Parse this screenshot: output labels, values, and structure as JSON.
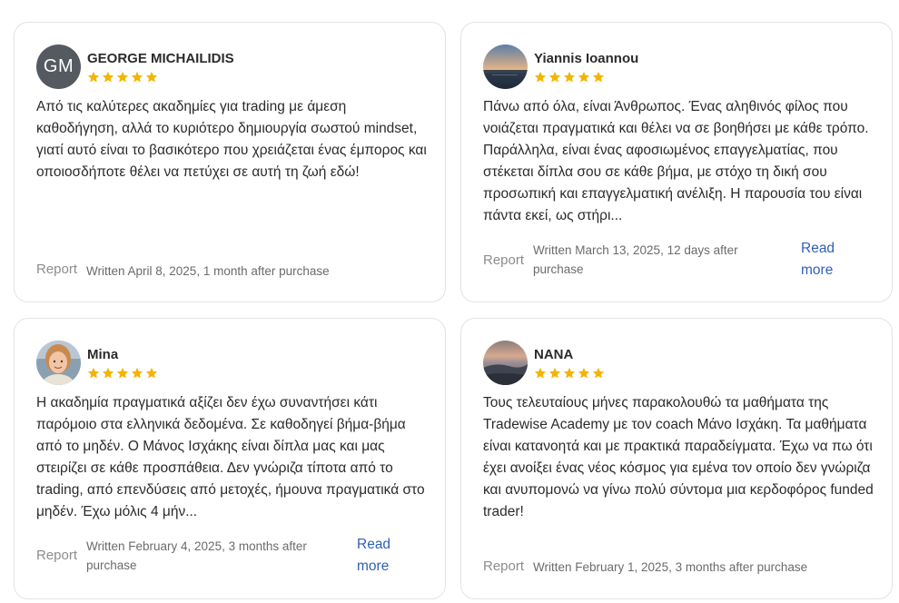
{
  "review_card_label": "Report",
  "colors": {
    "star": "#f4b400",
    "link": "#2f5fb8",
    "avatar_bg": "#555a60"
  },
  "reviews": [
    {
      "avatar_initials": "GM",
      "name": "GEORGE MICHAILIDIS",
      "rating": 5,
      "body": "Από τις καλύτερες ακαδημίες για trading με άμεση καθοδήγηση, αλλά το κυριότερο δημιουργία σωστού mindset, γιατί αυτό είναι το βασικότερο που χρειάζεται ένας έμπορος και οποιοσδήποτε θέλει να πετύχει σε αυτή τη ζωή εδώ!",
      "report": "Report",
      "written": "Written April 8, 2025, 1 month after purchase"
    },
    {
      "avatar_icon": "sunset-photo-avatar",
      "name": "Yiannis Ioannou",
      "rating": 5,
      "body": "Πάνω από όλα, είναι Άνθρωπος. Ένας αληθινός φίλος που νοιάζεται πραγματικά και θέλει να σε βοηθήσει με κάθε τρόπο. Παράλληλα, είναι ένας αφοσιωμένος επαγγελματίας, που στέκεται δίπλα σου σε κάθε βήμα, με στόχο τη δική σου προσωπική και επαγγελματική ανέλιξη. Η παρουσία του είναι πάντα εκεί, ως στήρι...",
      "report": "Report",
      "written": "Written March 13, 2025, 12 days after purchase",
      "read_more": [
        "Read",
        "more"
      ]
    },
    {
      "avatar_icon": "person-photo-avatar",
      "name": "Mina",
      "rating": 5,
      "body": "Η ακαδημία πραγματικά αξίζει δεν έχω συναντήσει κάτι παρόμοιο στα ελληνικά δεδομένα. Σε καθοδηγεί βήμα-βήμα από το μηδέν. Ο Μάνος Ισχάκης είναι δίπλα μας και μας στειρίζει σε κάθε προσπάθεια. Δεν γνώριζα τίποτα από το trading, από επενδύσεις από μετοχές, ήμουνα πραγματικά στο μηδέν. Έχω μόλις 4 μήν...",
      "report": "Report",
      "written": "Written February 4, 2025, 3 months after purchase",
      "read_more": [
        "Read",
        "more"
      ]
    },
    {
      "avatar_icon": "landscape-photo-avatar",
      "name": "NANA",
      "rating": 5,
      "body": "Τους τελευταίους μήνες παρακολουθώ τα μαθήματα της Tradewise Academy με τον coach Μάνο Ισχάκη. Τα μαθήματα είναι κατανοητά και με πρακτικά παραδείγματα. Έχω να πω ότι έχει ανοίξει ένας νέος κόσμος για εμένα τον οποίο δεν γνώριζα και ανυπομονώ να γίνω πολύ σύντομα μια κερδοφόρος funded trader!",
      "report": "Report",
      "written": "Written February 1, 2025, 3 months after purchase"
    }
  ]
}
